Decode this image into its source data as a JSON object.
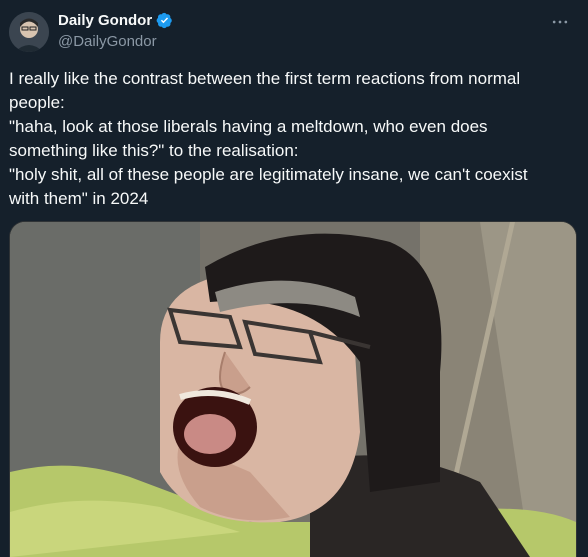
{
  "author": {
    "display_name": "Daily Gondor",
    "handle": "@DailyGondor",
    "verified": true
  },
  "tweet": {
    "lines": [
      "I really like the contrast between the first term reactions from normal",
      "people:",
      "\"haha, look at those liberals having a meltdown, who even does",
      "something like this?\" to the realisation:",
      "\"holy shit, all of these people are legitimately insane, we can't coexist",
      "with them\" in 2024"
    ]
  },
  "icons": {
    "verified": "verified-badge-icon",
    "more": "more-options-icon"
  },
  "colors": {
    "background": "#15202b",
    "text": "#f7f9f9",
    "secondary_text": "#8b98a5",
    "verified_blue": "#1d9bf0"
  }
}
